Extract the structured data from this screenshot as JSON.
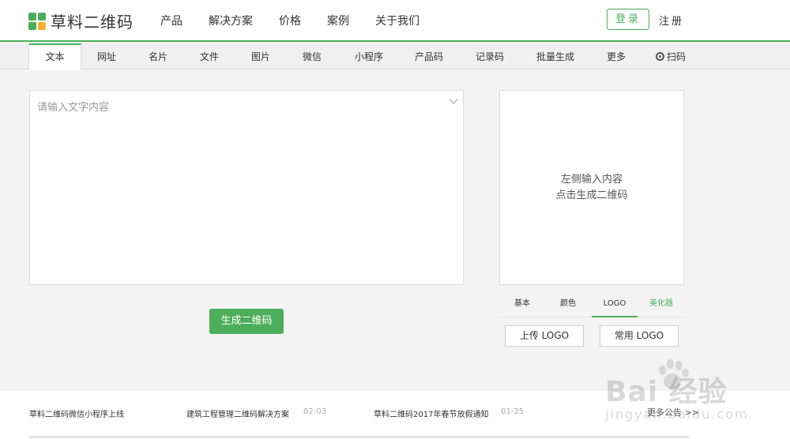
{
  "brand": {
    "name": "草料二维码"
  },
  "topnav": [
    "产品",
    "解决方案",
    "价格",
    "案例",
    "关于我们"
  ],
  "auth": {
    "login": "登录",
    "register": "注册"
  },
  "tabs": [
    "文本",
    "网址",
    "名片",
    "文件",
    "图片",
    "微信",
    "小程序",
    "产品码",
    "记录码",
    "批量生成",
    "更多",
    "扫码"
  ],
  "active_tab": "文本",
  "editor": {
    "placeholder": "请输入文字内容",
    "value": ""
  },
  "generate_button": "生成二维码",
  "preview": {
    "line1": "左侧输入内容",
    "line2": "点击生成二维码"
  },
  "option_tabs": [
    "基本",
    "颜色",
    "LOGO",
    "美化器"
  ],
  "active_option_tab": "LOGO",
  "logo_buttons": {
    "upload": "上传 LOGO",
    "common": "常用 LOGO"
  },
  "news": [
    {
      "title": "草料二维码微信小程序上线",
      "date": ""
    },
    {
      "title": "建筑工程管理二维码解决方案",
      "date": "02-03"
    },
    {
      "title": "草料二维码2017年春节放假通知",
      "date": "01-25"
    }
  ],
  "news_more": "更多公告 >>",
  "watermark": {
    "text": "Bai 经验",
    "sub": "jingyan.baidu.com"
  },
  "colors": {
    "accent": "#4cae5a",
    "logo_yellow": "#f2b134"
  }
}
